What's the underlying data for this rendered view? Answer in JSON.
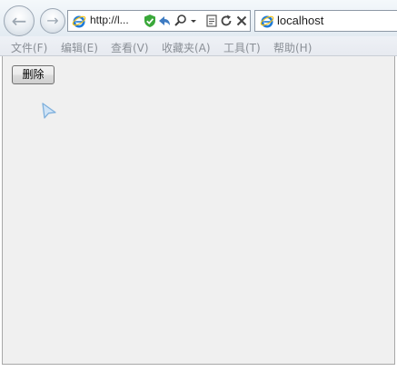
{
  "toolbar": {
    "back_icon": "back-arrow-icon",
    "forward_icon": "forward-arrow-icon",
    "address": "http://l...",
    "tab_title": "localhost"
  },
  "menu": {
    "items": [
      "文件(F)",
      "编辑(E)",
      "查看(V)",
      "收藏夹(A)",
      "工具(T)",
      "帮助(H)"
    ]
  },
  "page": {
    "delete_button": "删除"
  },
  "colors": {
    "content_bg": "#f0f0f0",
    "menu_text": "#8a8f96",
    "ie_blue": "#1f7ad8",
    "ie_ring": "#f3c21a",
    "shield_green": "#3aa83a"
  }
}
